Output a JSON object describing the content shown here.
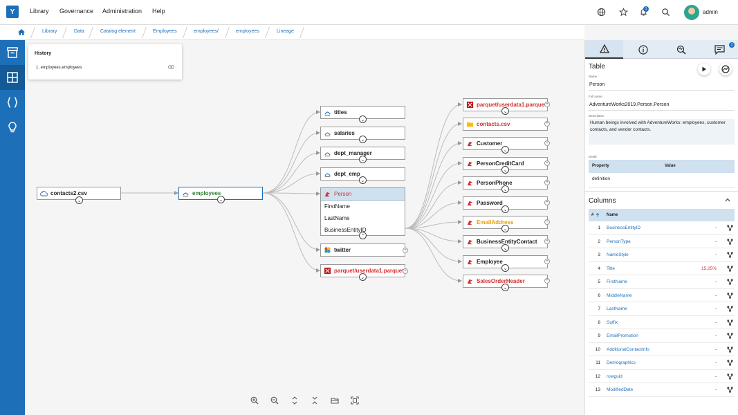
{
  "app": {
    "logo_letter": "Y",
    "user": "admin",
    "notification_count": "1"
  },
  "menu": [
    "Library",
    "Governance",
    "Administration",
    "Help"
  ],
  "breadcrumbs": [
    "Library",
    "Data",
    "Catalog element",
    "Employees",
    "employees/",
    "employees",
    "Lineage"
  ],
  "history": {
    "title": "History",
    "items": [
      "1. employees.employees"
    ]
  },
  "graph": {
    "source": {
      "label": "contacts2.csv"
    },
    "center": {
      "label": "employees"
    },
    "middle": [
      "titles",
      "salaries",
      "dept_manager",
      "dept_emp"
    ],
    "expanded": {
      "title": "Person",
      "rows": [
        "FirstName",
        "LastName",
        "BusinessEntityID"
      ]
    },
    "lower": [
      "twitter",
      "parquet/userdata1.parquet"
    ],
    "right": [
      "parquet/userdata1.parquet",
      "contacts.csv",
      "Customer",
      "PersonCreditCard",
      "PersonPhone",
      "Password",
      "EmailAddress",
      "BusinessEntityContact",
      "Employee",
      "SalesOrderHeader"
    ]
  },
  "panel": {
    "notes_badge": "1",
    "title": "Table",
    "name_label": "Name",
    "name": "Person",
    "fullname_label": "Full name",
    "fullname": "AdventureWorks2019.Person.Person",
    "description_label": "Description",
    "description": "Human beings involved with AdventureWorks: employees, customer contacts, and vendor contacts.",
    "detail_label": "Detail",
    "detail_headers": [
      "Property",
      "Value"
    ],
    "detail_rows": [
      "definition"
    ],
    "columns_title": "Columns",
    "col_headers": [
      "#",
      "Name"
    ],
    "columns": [
      {
        "num": "1",
        "name": "BusinessEntityID",
        "value": "-"
      },
      {
        "num": "2",
        "name": "PersonType",
        "value": "-"
      },
      {
        "num": "3",
        "name": "NameStyle",
        "value": "-"
      },
      {
        "num": "4",
        "name": "Title",
        "value": "15.25%"
      },
      {
        "num": "5",
        "name": "FirstName",
        "value": "-"
      },
      {
        "num": "6",
        "name": "MiddleName",
        "value": "-"
      },
      {
        "num": "7",
        "name": "LastName",
        "value": "-"
      },
      {
        "num": "8",
        "name": "Suffix",
        "value": "-"
      },
      {
        "num": "9",
        "name": "EmailPromotion",
        "value": "-"
      },
      {
        "num": "10",
        "name": "AdditionalContactInfo",
        "value": "-"
      },
      {
        "num": "11",
        "name": "Demographics",
        "value": "-"
      },
      {
        "num": "12",
        "name": "rowguid",
        "value": "-"
      },
      {
        "num": "13",
        "name": "ModifiedDate",
        "value": "-"
      }
    ]
  },
  "colors": {
    "accent": "#1d6fb8",
    "red": "#d32f2f",
    "orange": "#e6a000",
    "green": "#2e7d32"
  }
}
